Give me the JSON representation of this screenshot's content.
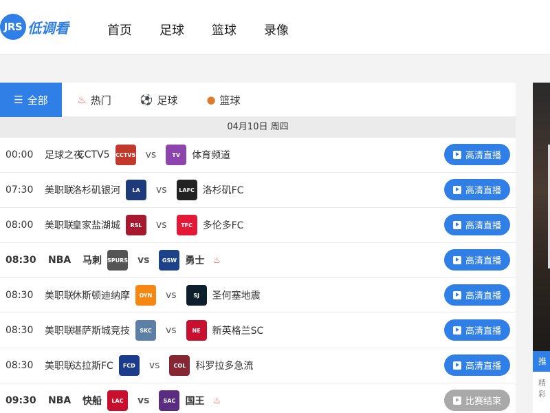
{
  "header": {
    "logo_badge": "JRS",
    "logo_text": "低调看",
    "nav": [
      "首页",
      "足球",
      "篮球",
      "录像"
    ]
  },
  "tabs": [
    {
      "label": "全部",
      "icon": "list-icon"
    },
    {
      "label": "热门",
      "icon": "fire-icon"
    },
    {
      "label": "足球",
      "icon": "soccer-ball-icon"
    },
    {
      "label": "篮球",
      "icon": "basketball-icon"
    }
  ],
  "date_bar": "04月10日 周四",
  "colors": {
    "accent": "#2f7fe6",
    "hot": "#e8553a",
    "ended": "#a9a9a9"
  },
  "matches": [
    {
      "time": "00:00",
      "league": "足球之夜",
      "home": "CCTV5",
      "away": "体育频道",
      "hot": false,
      "button": "高清直播",
      "ended": false,
      "home_logo": "#c0392b",
      "away_logo": "#8e44ad",
      "home_abbr": "CCTV5",
      "away_abbr": "TV"
    },
    {
      "time": "07:30",
      "league": "美职联",
      "home": "洛杉矶银河",
      "away": "洛杉矶FC",
      "hot": false,
      "button": "高清直播",
      "ended": false,
      "home_logo": "#1d3a7a",
      "away_logo": "#222222",
      "home_abbr": "LA",
      "away_abbr": "LAFC"
    },
    {
      "time": "08:00",
      "league": "美职联",
      "home": "皇家盐湖城",
      "away": "多伦多FC",
      "hot": false,
      "button": "高清直播",
      "ended": false,
      "home_logo": "#a6192e",
      "away_logo": "#e31937",
      "home_abbr": "RSL",
      "away_abbr": "TFC"
    },
    {
      "time": "08:30",
      "league": "NBA",
      "home": "马刺",
      "away": "勇士",
      "hot": true,
      "button": "高清直播",
      "ended": false,
      "home_logo": "#555555",
      "away_logo": "#1d428a",
      "home_abbr": "SPURS",
      "away_abbr": "GSW"
    },
    {
      "time": "08:30",
      "league": "美职联",
      "home": "休斯顿迪纳摩",
      "away": "圣何塞地震",
      "hot": false,
      "button": "高清直播",
      "ended": false,
      "home_logo": "#f68712",
      "away_logo": "#0d1f2d",
      "home_abbr": "DYN",
      "away_abbr": "SJ"
    },
    {
      "time": "08:30",
      "league": "美职联",
      "home": "堪萨斯城竞技",
      "away": "新英格兰SC",
      "hot": false,
      "button": "高清直播",
      "ended": false,
      "home_logo": "#5b7fa6",
      "away_logo": "#c8102e",
      "home_abbr": "SKC",
      "away_abbr": "NE"
    },
    {
      "time": "08:30",
      "league": "美职联",
      "home": "达拉斯FC",
      "away": "科罗拉多急流",
      "hot": false,
      "button": "高清直播",
      "ended": false,
      "home_logo": "#1b3c8c",
      "away_logo": "#862633",
      "home_abbr": "FCD",
      "away_abbr": "COL"
    },
    {
      "time": "09:30",
      "league": "NBA",
      "home": "快船",
      "away": "国王",
      "hot": true,
      "button": "比赛结束",
      "ended": true,
      "home_logo": "#c8102e",
      "away_logo": "#5a2d81",
      "home_abbr": "LAC",
      "away_abbr": "SAC"
    }
  ],
  "side": {
    "tab_label": "推荐",
    "bottom_text": "精彩"
  }
}
